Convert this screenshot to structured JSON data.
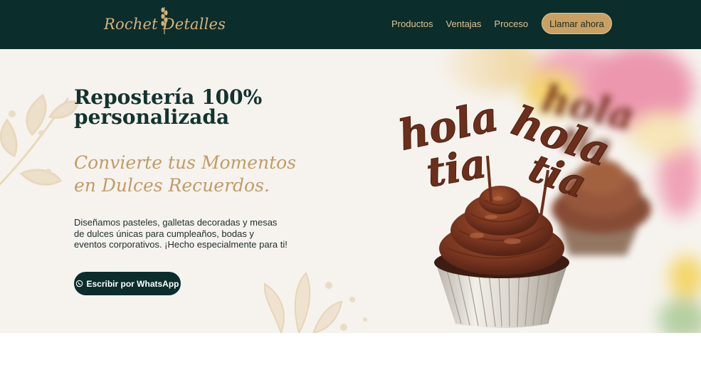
{
  "header": {
    "logo_text": "Rochet Detalles",
    "nav": [
      "Productos",
      "Ventajas",
      "Proceso"
    ],
    "cta_label": "Llamar ahora"
  },
  "hero": {
    "title": "Repostería 100% personalizada",
    "script_line_1": "Convierte tus Momentos",
    "script_line_2": "en Dulces Recuerdos.",
    "description": "Diseñamos pasteles, galletas decoradas y mesas de dulces únicas para cumpleaños, bodas y eventos corporativos. ¡Hecho especialmente para ti!",
    "whatsapp_label": "Escribir por WhatsApp",
    "topper_text": "hola tia"
  },
  "colors": {
    "primary_dark": "#0b2d2c",
    "gold": "#c8a063",
    "hero_bg": "#f6f3ee",
    "chocolate": "#6b2f1c"
  },
  "icons": [
    "logo-sprig-icon",
    "whatsapp-icon",
    "leaf-decoration-icon"
  ]
}
